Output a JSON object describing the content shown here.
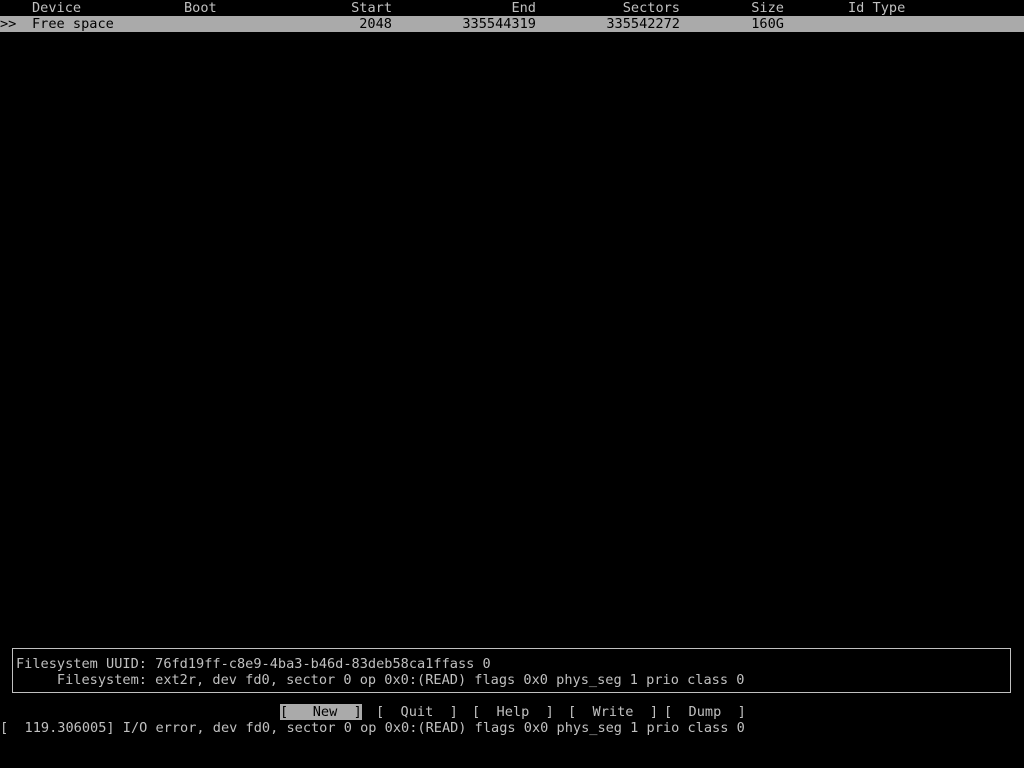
{
  "header": {
    "device": "Device",
    "boot": "Boot",
    "start": "Start",
    "end": "End",
    "sectors": "Sectors",
    "size": "Size",
    "id_type": "Id Type"
  },
  "rows": [
    {
      "marker": ">>",
      "device": "Free space",
      "boot": "",
      "start": "2048",
      "end": "335544319",
      "sectors": "335542272",
      "size": "160G",
      "id_type": ""
    }
  ],
  "info_panel": {
    "line1": "Filesystem UUID: 76fd19ff-c8e9-4ba3-b46d-83deb58ca1ffass 0",
    "line2": "     Filesystem: ext2r, dev fd0, sector 0 op 0x0:(READ) flags 0x0 phys_seg 1 prio class 0"
  },
  "menu": {
    "new": "[   New  ]",
    "quit": "[  Quit  ]",
    "help": "[  Help  ]",
    "write": "[  Write  ]",
    "dump": "[  Dump  ]"
  },
  "kernel_message": "[  119.306005] I/O error, dev fd0, sector 0 op 0x0:(READ) flags 0x0 phys_seg 1 prio class 0",
  "colors": {
    "background": "#000000",
    "foreground": "#c0c0c0",
    "selection_bg": "#aaaaaa",
    "selection_fg": "#000000"
  }
}
